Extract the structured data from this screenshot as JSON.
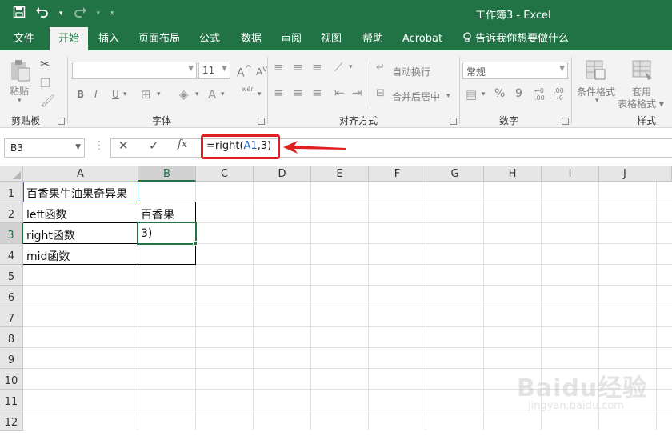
{
  "window": {
    "title": "工作簿3  -  Excel"
  },
  "qat": {
    "save_icon": "save-icon",
    "undo_icon": "undo-icon",
    "redo_icon": "redo-icon",
    "customize_icon": "customize-qat-icon"
  },
  "tabs": [
    {
      "label": "文件"
    },
    {
      "label": "开始"
    },
    {
      "label": "插入"
    },
    {
      "label": "页面布局"
    },
    {
      "label": "公式"
    },
    {
      "label": "数据"
    },
    {
      "label": "审阅"
    },
    {
      "label": "视图"
    },
    {
      "label": "帮助"
    },
    {
      "label": "Acrobat"
    }
  ],
  "tell_me": "告诉我你想要做什么",
  "ribbon": {
    "clipboard": {
      "paste": "粘贴",
      "label": "剪贴板"
    },
    "font": {
      "font_size": "11",
      "label": "字体",
      "bold": "B",
      "italic": "I",
      "underline": "U",
      "phonetic": "wén"
    },
    "alignment": {
      "wrap": "自动换行",
      "merge": "合并后居中",
      "label": "对齐方式"
    },
    "number": {
      "format": "常规",
      "label": "数字",
      "percent": "%",
      "comma": "9"
    },
    "styles": {
      "cond": "条件格式",
      "table": "套用\n表格格式",
      "label": "样式"
    }
  },
  "formula_bar": {
    "name_box": "B3",
    "fx": "fx",
    "formula_prefix": "=right(",
    "formula_ref": "A1",
    "formula_suffix": ",3)"
  },
  "columns": [
    "A",
    "B",
    "C",
    "D",
    "E",
    "F",
    "G",
    "H",
    "I",
    "J"
  ],
  "rows": [
    "1",
    "2",
    "3",
    "4",
    "5",
    "6",
    "7",
    "8",
    "9",
    "10",
    "11",
    "12"
  ],
  "cells": {
    "A1": "百香果牛油果奇异果",
    "A2": "left函数",
    "B2": "百香果",
    "A3": "right函数",
    "B3": "3)",
    "A4": "mid函数"
  },
  "watermark": {
    "main": "Baidu经验",
    "sub": "jingyan.baidu.com"
  },
  "colors": {
    "excel_green": "#217346",
    "annotation_red": "#e02020",
    "ref_blue": "#1f5fbf"
  }
}
